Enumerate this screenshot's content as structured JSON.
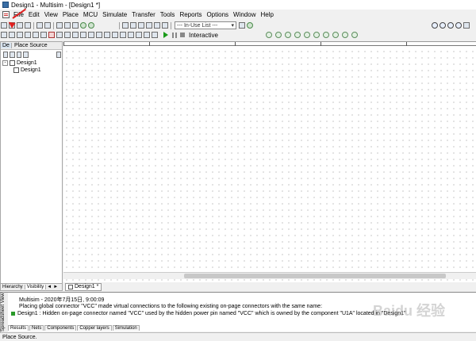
{
  "window": {
    "title": "Design1 - Multisim - [Design1 *]"
  },
  "menu": [
    "File",
    "Edit",
    "View",
    "Place",
    "MCU",
    "Simulate",
    "Transfer",
    "Tools",
    "Reports",
    "Options",
    "Window",
    "Help"
  ],
  "toolbar": {
    "in_use_list": "--- In-Use List ---",
    "interactive_label": "Interactive"
  },
  "left_panel": {
    "tag": "De",
    "title": "Place Source",
    "tree": [
      {
        "label": "Design1",
        "expander": "-"
      },
      {
        "label": "Design1"
      }
    ],
    "tabs": [
      "Hierarchy",
      "Visibility"
    ],
    "nav": [
      "◄",
      "►"
    ]
  },
  "document_tabs": [
    "Design1 *"
  ],
  "spreadsheet": {
    "side_label": "Spreadsheet View",
    "lines": [
      "Multisim  -  2020年7月15日, 9:00:09",
      "Placing global connector \"VCC\" made virtual connections to the following existing on-page connectors with the same name:",
      "Design1 : Hidden on-page connector named \"VCC\" used by the hidden power pin named \"VCC\" which is owned by the component \"U1A\" located in \"Design1\""
    ],
    "tabs": [
      "Results",
      "Nets",
      "Components",
      "Copper layers",
      "Simulation"
    ]
  },
  "status_bar": {
    "text": "Place Source."
  },
  "watermark": "Baidu 经验",
  "colors": {
    "accent_green": "#2a9a2a",
    "arrow_red": "#e02020"
  }
}
